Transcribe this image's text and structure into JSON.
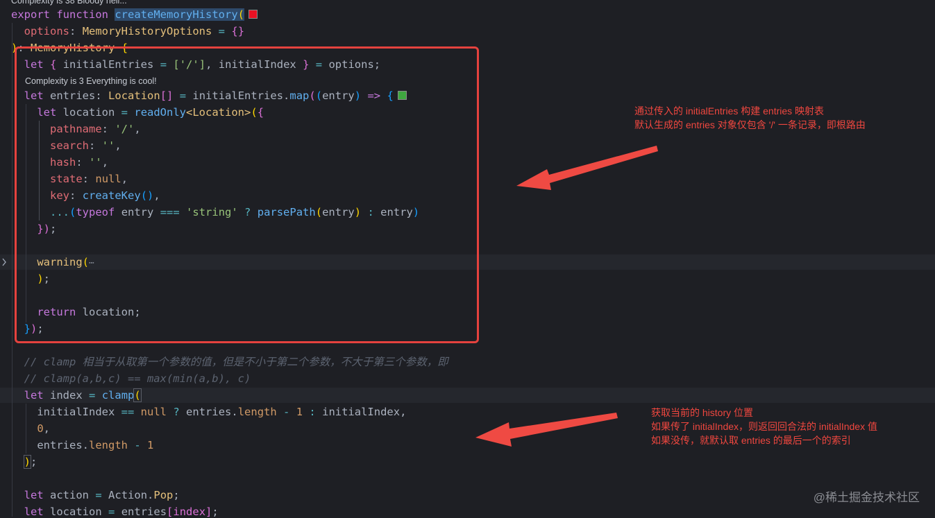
{
  "lenses": {
    "top": "Complexity is 38 Bloody hell...",
    "inner": "Complexity is 3 Everything is cool!"
  },
  "code": {
    "l1": {
      "export": "export",
      "function": "function",
      "name": "createMemoryHistory",
      "paren": "("
    },
    "l2": {
      "param": "options",
      "colon": ":",
      "type": "MemoryHistoryOptions",
      "eq": "=",
      "obj": "{}"
    },
    "l3": {
      "paren": ")",
      "colon": ":",
      "type": "MemoryHistory",
      "brace": "{"
    },
    "l4": {
      "let": "let",
      "open": "{",
      "a": "initialEntries",
      "eq": "=",
      "arr": "['/']",
      "comma": ",",
      "b": "initialIndex",
      "close": "}",
      "eq2": "=",
      "src": "options;"
    },
    "l5": {
      "let": "let",
      "name": "entries",
      "colon": ":",
      "type": "Location",
      "arr": "[]",
      "eq": "=",
      "obj": "initialEntries",
      "dot": ".",
      "method": "map",
      "open": "(",
      "open2": "(",
      "param": "entry",
      "close": ")",
      "arrow": "=>",
      "brace": "{"
    },
    "l6": {
      "let": "let",
      "name": "location",
      "eq": "=",
      "fn": "readOnly",
      "generic": "<Location>",
      "open": "(",
      "brace": "{"
    },
    "l7": {
      "key": "pathname",
      "colon": ":",
      "val": "'/'",
      "comma": ","
    },
    "l8": {
      "key": "search",
      "colon": ":",
      "val": "''",
      "comma": ","
    },
    "l9": {
      "key": "hash",
      "colon": ":",
      "val": "''",
      "comma": ","
    },
    "l10": {
      "key": "state",
      "colon": ":",
      "val": "null",
      "comma": ","
    },
    "l11": {
      "key": "key",
      "colon": ":",
      "fn": "createKey",
      "call": "()",
      "comma": ","
    },
    "l12": {
      "spread": "...",
      "open": "(",
      "typeof": "typeof",
      "name": "entry",
      "op": "===",
      "str": "'string'",
      "q": "?",
      "fn": "parsePath",
      "open2": "(",
      "arg": "entry",
      "close2": ")",
      "c": ":",
      "alt": "entry",
      "close": ")"
    },
    "l13": {
      "close": "})",
      "semi": ";"
    },
    "l14": {
      "fn": "warning",
      "open": "(",
      "ellipsis": "⋯"
    },
    "l15": {
      "close": ")",
      "semi": ";"
    },
    "l16": {
      "ret": "return",
      "val": "location;"
    },
    "l17": {
      "brace": "}",
      "close": ")",
      "semi": ";"
    },
    "l18": "// clamp 相当于从取第一个参数的值，但是不小于第二个参数，不大于第三个参数，即",
    "l19": "// clamp(a,b,c) == max(min(a,b), c)",
    "l20": {
      "let": "let",
      "name": "index",
      "eq": "=",
      "fn": "clamp",
      "open": "("
    },
    "l21": {
      "a": "initialIndex",
      "op": "==",
      "nul": "null",
      "q": "?",
      "obj": "entries",
      "dot": ".",
      "prop": "length",
      "minus": "-",
      "num": "1",
      "c": ":",
      "b": "initialIndex,"
    },
    "l22": {
      "num": "0",
      "comma": ","
    },
    "l23": {
      "obj": "entries",
      "dot": ".",
      "prop": "length",
      "minus": "-",
      "num": "1"
    },
    "l24": {
      "close": ")",
      "semi": ";"
    },
    "l26": {
      "let": "let",
      "name": "action",
      "eq": "=",
      "obj": "Action",
      "dot": ".",
      "prop": "Pop",
      "semi": ";"
    },
    "l27": {
      "let": "let",
      "name": "location",
      "eq": "=",
      "obj": "entries",
      "idx": "[index]",
      "semi": ";"
    }
  },
  "annotations": {
    "entries_note": [
      "通过传入的 initialEntries 构建 entries 映射表",
      "默认生成的 entries 对象仅包含 '/' 一条记录，即根路由"
    ],
    "index_note": [
      "获取当前的 history 位置",
      "如果传了 initialIndex，则返回回合法的 initialIndex 值",
      "如果没传，就默认取 entries 的最后一个的索引"
    ]
  },
  "watermark": "@稀土掘金技术社区",
  "colors": {
    "annotation": "#f0473f",
    "complexity_high": "#e81123",
    "complexity_low": "#3fa63f",
    "background": "#1e1f24"
  }
}
